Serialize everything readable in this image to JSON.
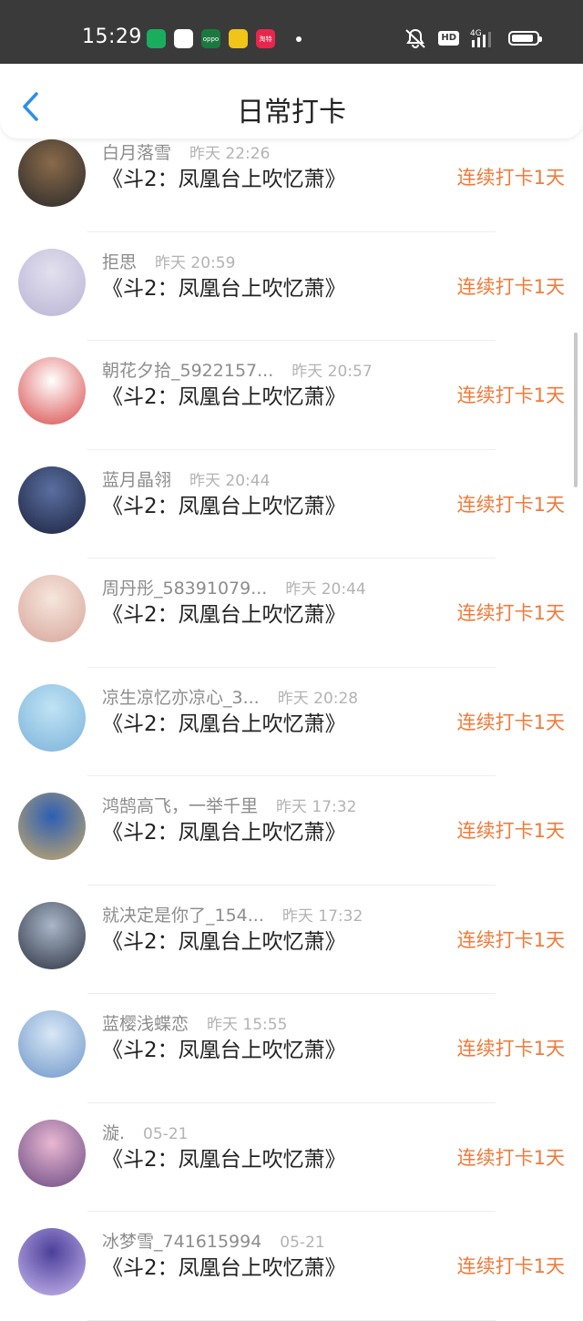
{
  "status_bar": {
    "time": "15:29",
    "app_icons": [
      {
        "name": "wechat-app-icon",
        "color": "#1aad5e",
        "label": ""
      },
      {
        "name": "browser-app-icon",
        "color": "#ffffff",
        "label": ""
      },
      {
        "name": "oppo-app-icon",
        "color": "#1a7a3e",
        "label": "oppo"
      },
      {
        "name": "store-app-icon",
        "color": "#f0c419",
        "label": ""
      },
      {
        "name": "taobao-app-icon",
        "color": "#e8264c",
        "label": "淘特"
      }
    ],
    "hd_label": "HD",
    "network_label": "4G"
  },
  "navbar": {
    "title": "日常打卡"
  },
  "checkins": [
    {
      "name": "白月落雪",
      "time": "昨天 22:26",
      "title": "《斗2：凤凰台上吹忆萧》",
      "streak": "连续打卡1天",
      "avatar_colors": [
        "#8a6a4a",
        "#2a2a2a"
      ]
    },
    {
      "name": "拒思",
      "time": "昨天 20:59",
      "title": "《斗2：凤凰台上吹忆萧》",
      "streak": "连续打卡1天",
      "avatar_colors": [
        "#e3e0ef",
        "#b9b4d4"
      ]
    },
    {
      "name": "朝花夕拾_5922157...",
      "time": "昨天 20:57",
      "title": "《斗2：凤凰台上吹忆萧》",
      "streak": "连续打卡1天",
      "avatar_colors": [
        "#ffffff",
        "#d94a4a"
      ]
    },
    {
      "name": "蓝月晶翎",
      "time": "昨天 20:44",
      "title": "《斗2：凤凰台上吹忆萧》",
      "streak": "连续打卡1天",
      "avatar_colors": [
        "#5a6fa0",
        "#1c2440"
      ]
    },
    {
      "name": "周丹彤_58391079...",
      "time": "昨天 20:44",
      "title": "《斗2：凤凰台上吹忆萧》",
      "streak": "连续打卡1天",
      "avatar_colors": [
        "#f6e6dc",
        "#d7a59a"
      ]
    },
    {
      "name": "凉生凉忆亦凉心_3...",
      "time": "昨天 20:28",
      "title": "《斗2：凤凰台上吹忆萧》",
      "streak": "连续打卡1天",
      "avatar_colors": [
        "#bfe3f4",
        "#7cb3da"
      ]
    },
    {
      "name": "鸿鹄高飞，一举千里",
      "time": "昨天 17:32",
      "title": "《斗2：凤凰台上吹忆萧》",
      "streak": "连续打卡1天",
      "avatar_colors": [
        "#2b5fb5",
        "#c8a96a"
      ]
    },
    {
      "name": "就决定是你了_154...",
      "time": "昨天 17:32",
      "title": "《斗2：凤凰台上吹忆萧》",
      "streak": "连续打卡1天",
      "avatar_colors": [
        "#a9b7c9",
        "#2e3442"
      ]
    },
    {
      "name": "蓝樱浅蝶恋",
      "time": "昨天 15:55",
      "title": "《斗2：凤凰台上吹忆萧》",
      "streak": "连续打卡1天",
      "avatar_colors": [
        "#d8e8f6",
        "#6f96c9"
      ]
    },
    {
      "name": "漩.",
      "time": "05-21",
      "title": "《斗2：凤凰台上吹忆萧》",
      "streak": "连续打卡1天",
      "avatar_colors": [
        "#e9b7d2",
        "#6a4a82"
      ]
    },
    {
      "name": "冰梦雪_741615994",
      "time": "05-21",
      "title": "《斗2：凤凰台上吹忆萧》",
      "streak": "连续打卡1天",
      "avatar_colors": [
        "#4c3f9a",
        "#c9b8ef"
      ]
    }
  ]
}
